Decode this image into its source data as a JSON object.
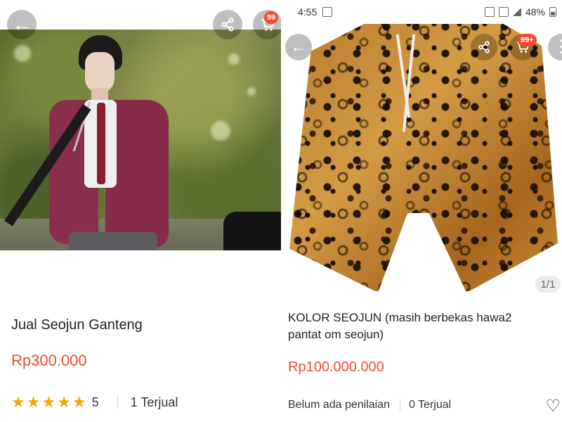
{
  "left_panel": {
    "title": "Jual Seojun Ganteng",
    "price": "Rp300.000",
    "rating": 5,
    "rating_text": "5",
    "sold": "1 Terjual",
    "badge": "99",
    "icons": {
      "back": "back-icon",
      "share": "share-icon",
      "cart": "cart-icon"
    }
  },
  "right_panel": {
    "status_time": "4:55",
    "battery_text": "48%",
    "badge": "99+",
    "title": "KOLOR SEOJUN (masih berbekas hawa2 pantat om seojun)",
    "price": "Rp100.000.000",
    "rating_text": "Belum ada penilaian",
    "sold": "0 Terjual",
    "page_indicator": "1/1",
    "icons": {
      "back": "back-icon",
      "share": "share-icon",
      "cart": "cart-icon",
      "more": "more-icon",
      "favorite": "heart-icon"
    }
  },
  "colors": {
    "accent": "#ee4d2d",
    "star": "#f6a700"
  }
}
